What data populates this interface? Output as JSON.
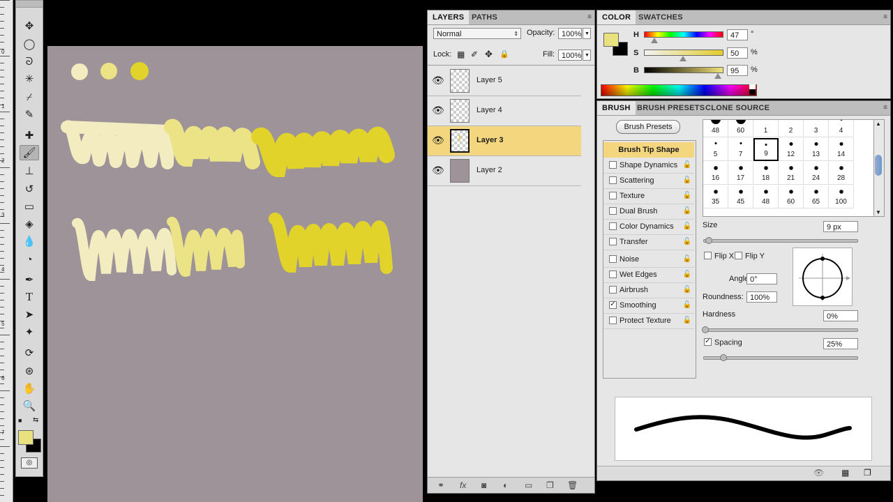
{
  "ruler": {
    "labels": [
      "0",
      "1",
      "2",
      "3",
      "4",
      "5",
      "6",
      "7"
    ]
  },
  "toolbox": {
    "tools": [
      "move-tool",
      "marquee-tool",
      "lasso-tool",
      "quick-select-tool",
      "crop-tool",
      "eyedropper-tool",
      "spot-heal-tool",
      "brush-tool",
      "clone-stamp-tool",
      "history-brush-tool",
      "eraser-tool",
      "paint-bucket-tool",
      "blur-tool",
      "dodge-tool",
      "pen-tool",
      "type-tool",
      "path-select-tool",
      "shape-tool",
      "3d-rotate-tool",
      "3d-orbit-tool",
      "hand-tool",
      "zoom-tool"
    ],
    "type_glyph": "T",
    "foreground_color": "#e9e17f",
    "background_color": "#000000"
  },
  "canvas": {
    "background": "#9e9398",
    "swatches": [
      "#f2ecc0",
      "#ece286",
      "#e2d32b"
    ]
  },
  "layers_panel": {
    "tabs": [
      "LAYERS",
      "PATHS"
    ],
    "blend_mode": "Normal",
    "opacity_label": "Opacity:",
    "opacity_value": "100%",
    "lock_label": "Lock:",
    "fill_label": "Fill:",
    "fill_value": "100%",
    "layers": [
      {
        "name": "Layer 5",
        "selected": false
      },
      {
        "name": "Layer 4",
        "selected": false
      },
      {
        "name": "Layer 3",
        "selected": true
      },
      {
        "name": "Layer 2",
        "selected": false
      }
    ]
  },
  "color_panel": {
    "tabs": [
      "COLOR",
      "SWATCHES"
    ],
    "h_label": "H",
    "h_value": "47",
    "h_unit": "°",
    "s_label": "S",
    "s_value": "50",
    "s_unit": "%",
    "b_label": "B",
    "b_value": "95",
    "b_unit": "%",
    "h_level": 0.13,
    "s_level": 0.5,
    "b_level": 0.95
  },
  "brush_panel": {
    "tabs": [
      "BRUSH",
      "BRUSH PRESETS",
      "CLONE SOURCE"
    ],
    "presets_button": "Brush Presets",
    "tip_shape_label": "Brush Tip Shape",
    "options": [
      {
        "label": "Shape Dynamics",
        "checked": false
      },
      {
        "label": "Scattering",
        "checked": false
      },
      {
        "label": "Texture",
        "checked": false
      },
      {
        "label": "Dual Brush",
        "checked": false
      },
      {
        "label": "Color Dynamics",
        "checked": false
      },
      {
        "label": "Transfer",
        "checked": false
      },
      {
        "label": "Noise",
        "checked": false
      },
      {
        "label": "Wet Edges",
        "checked": false
      },
      {
        "label": "Airbrush",
        "checked": false
      },
      {
        "label": "Smoothing",
        "checked": true
      },
      {
        "label": "Protect Texture",
        "checked": false
      }
    ],
    "tip_sizes": [
      "48",
      "60",
      "1",
      "2",
      "3",
      "4",
      "5",
      "7",
      "9",
      "12",
      "13",
      "14",
      "16",
      "17",
      "18",
      "21",
      "24",
      "28",
      "35",
      "45",
      "48",
      "60",
      "65",
      "100"
    ],
    "selected_tip": "9",
    "size_label": "Size",
    "size_value": "9 px",
    "flip_x": "Flip X",
    "flip_y": "Flip Y",
    "angle_label": "Angle:",
    "angle_value": "0°",
    "roundness_label": "Roundness:",
    "roundness_value": "100%",
    "hardness_label": "Hardness",
    "hardness_value": "0%",
    "spacing_label": "Spacing",
    "spacing_value": "25%",
    "spacing_checked": true
  }
}
